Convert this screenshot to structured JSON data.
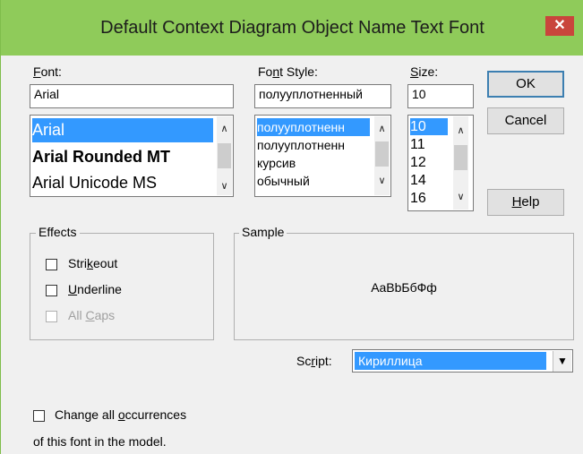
{
  "dialog": {
    "title": "Default Context Diagram Object Name Text Font",
    "close_glyph": "✕"
  },
  "font": {
    "label_prefix": "",
    "label_accel": "F",
    "label_rest": "ont:",
    "value": "Arial",
    "items": [
      "Arial",
      "Arial Rounded MT",
      "Arial Unicode MS"
    ]
  },
  "style": {
    "label_prefix": "Fo",
    "label_accel": "n",
    "label_rest": "t Style:",
    "value": "полууплотненный",
    "items": [
      "полууплотненн",
      "полууплотненн",
      "курсив",
      "обычный"
    ]
  },
  "size": {
    "label_accel": "S",
    "label_rest": "ize:",
    "value": "10",
    "items": [
      "10",
      "11",
      "12",
      "14",
      "16"
    ]
  },
  "buttons": {
    "ok": "OK",
    "cancel": "Cancel",
    "help_accel": "H",
    "help_rest": "elp"
  },
  "effects": {
    "title": "Effects",
    "strikeout_pre": "Stri",
    "strikeout_accel": "k",
    "strikeout_post": "eout",
    "underline_accel": "U",
    "underline_post": "nderline",
    "allcaps_pre": "All ",
    "allcaps_accel": "C",
    "allcaps_post": "aps"
  },
  "sample": {
    "title": "Sample",
    "text": "AaBbБбФф"
  },
  "script": {
    "label_pre": "Sc",
    "label_accel": "r",
    "label_post": "ipt:",
    "value": "Кириллица"
  },
  "change_all": {
    "line1_pre": "Change all ",
    "line1_accel": "o",
    "line1_post": "ccurrences",
    "line2": "of this font in the model."
  },
  "colors": {
    "titlebar": "#8fcb5a",
    "selection": "#3399ff",
    "close": "#c9453c"
  }
}
